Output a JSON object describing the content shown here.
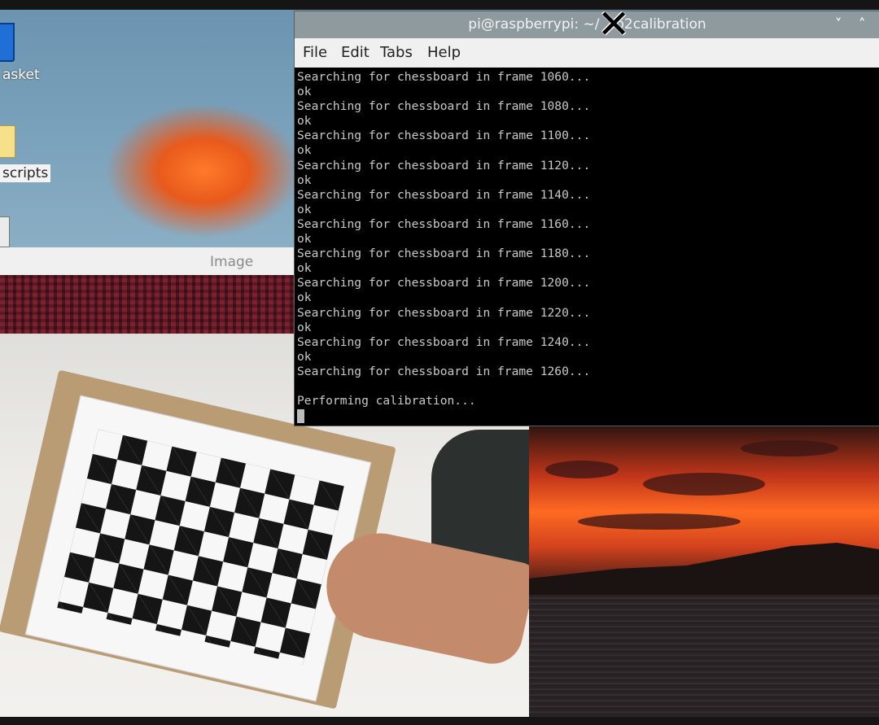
{
  "desktop": {
    "icons": [
      {
        "label": "asket"
      },
      {
        "label": "scripts"
      }
    ]
  },
  "image_viewer": {
    "title": "Image"
  },
  "terminal": {
    "title": "pi@raspberrypi: ~/",
    "title_suffix": "o2calibration",
    "controls": {
      "minimize": "˅",
      "maximize": "˄"
    },
    "menu": [
      "File",
      "Edit",
      "Tabs",
      "Help"
    ],
    "lines": [
      "Searching for chessboard in frame 1060...",
      "ok",
      "Searching for chessboard in frame 1080...",
      "ok",
      "Searching for chessboard in frame 1100...",
      "ok",
      "Searching for chessboard in frame 1120...",
      "ok",
      "Searching for chessboard in frame 1140...",
      "ok",
      "Searching for chessboard in frame 1160...",
      "ok",
      "Searching for chessboard in frame 1180...",
      "ok",
      "Searching for chessboard in frame 1200...",
      "ok",
      "Searching for chessboard in frame 1220...",
      "ok",
      "Searching for chessboard in frame 1240...",
      "ok",
      "Searching for chessboard in frame 1260...",
      "",
      "Performing calibration..."
    ]
  },
  "colors": {
    "terminal_bg": "#000000",
    "terminal_text": "#c9c9c9",
    "titlebar": "#8f9a9e",
    "menubar": "#f0f0f0"
  }
}
